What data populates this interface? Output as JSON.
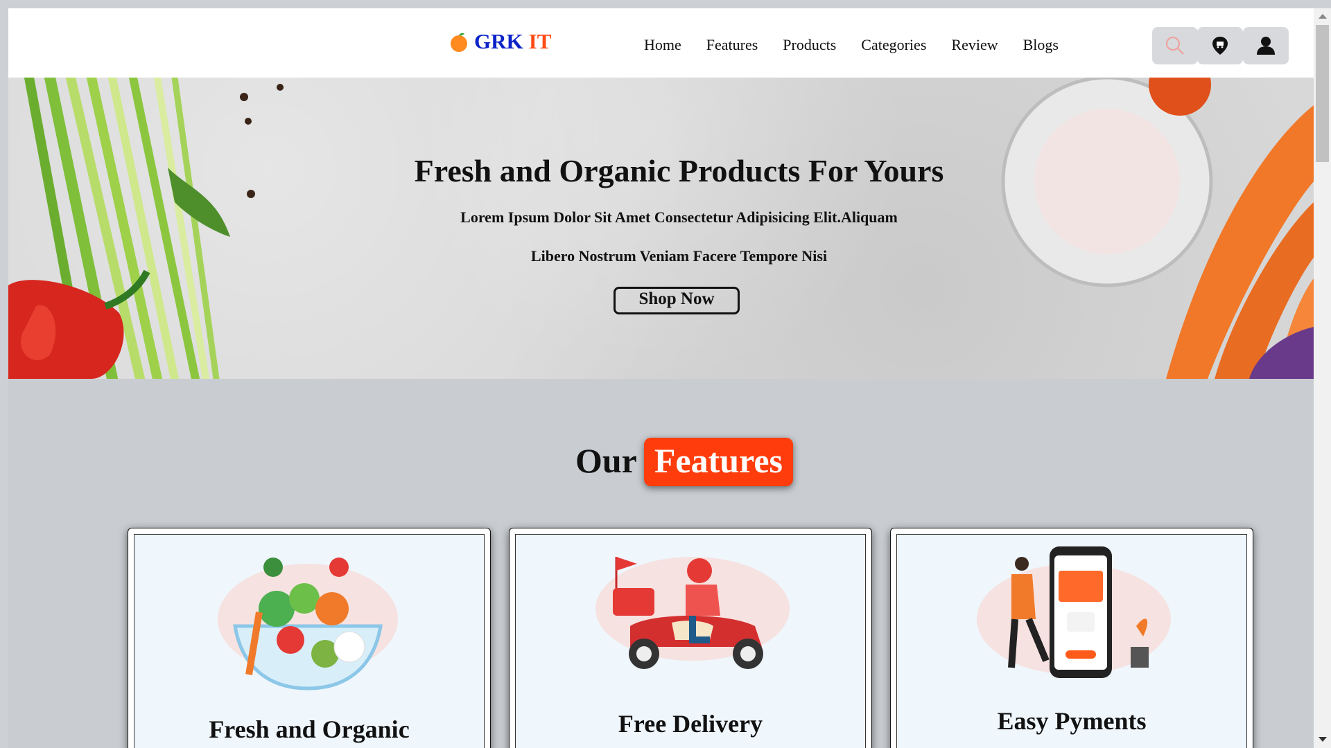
{
  "header": {
    "logo_part1": "GRK",
    "logo_part2": "IT",
    "nav": [
      "Home",
      "Features",
      "Products",
      "Categories",
      "Review",
      "Blogs"
    ],
    "icons": [
      "search-icon",
      "cart-location-icon",
      "user-icon"
    ]
  },
  "hero": {
    "title": "Fresh and Organic Products For Yours",
    "line1": "Lorem Ipsum Dolor Sit Amet Consectetur Adipisicing Elit.Aliquam",
    "line2": "Libero Nostrum Veniam Facere Tempore Nisi",
    "button": "Shop Now"
  },
  "features": {
    "heading_plain": "Our",
    "heading_badge": "Features",
    "cards": [
      {
        "title": "Fresh and Organic",
        "icon": "vegetable-bowl-illustration"
      },
      {
        "title": "Free Delivery",
        "icon": "delivery-scooter-illustration"
      },
      {
        "title": "Easy Pyments",
        "icon": "phone-payment-illustration"
      }
    ]
  },
  "colors": {
    "brand_blue": "#0b23c9",
    "brand_orange": "#ff4a14",
    "badge": "#ff3d0c",
    "page_bg": "#c9cdd1"
  }
}
